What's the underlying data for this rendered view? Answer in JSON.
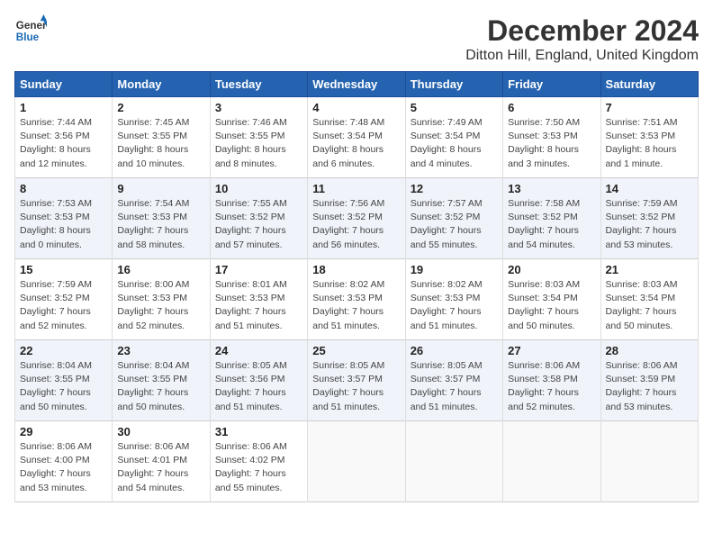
{
  "header": {
    "logo_line1": "General",
    "logo_line2": "Blue",
    "month": "December 2024",
    "location": "Ditton Hill, England, United Kingdom"
  },
  "days_of_week": [
    "Sunday",
    "Monday",
    "Tuesday",
    "Wednesday",
    "Thursday",
    "Friday",
    "Saturday"
  ],
  "weeks": [
    [
      {
        "day": 1,
        "sunrise": "7:44 AM",
        "sunset": "3:56 PM",
        "daylight": "8 hours and 12 minutes"
      },
      {
        "day": 2,
        "sunrise": "7:45 AM",
        "sunset": "3:55 PM",
        "daylight": "8 hours and 10 minutes"
      },
      {
        "day": 3,
        "sunrise": "7:46 AM",
        "sunset": "3:55 PM",
        "daylight": "8 hours and 8 minutes"
      },
      {
        "day": 4,
        "sunrise": "7:48 AM",
        "sunset": "3:54 PM",
        "daylight": "8 hours and 6 minutes"
      },
      {
        "day": 5,
        "sunrise": "7:49 AM",
        "sunset": "3:54 PM",
        "daylight": "8 hours and 4 minutes"
      },
      {
        "day": 6,
        "sunrise": "7:50 AM",
        "sunset": "3:53 PM",
        "daylight": "8 hours and 3 minutes"
      },
      {
        "day": 7,
        "sunrise": "7:51 AM",
        "sunset": "3:53 PM",
        "daylight": "8 hours and 1 minute"
      }
    ],
    [
      {
        "day": 8,
        "sunrise": "7:53 AM",
        "sunset": "3:53 PM",
        "daylight": "8 hours and 0 minutes"
      },
      {
        "day": 9,
        "sunrise": "7:54 AM",
        "sunset": "3:53 PM",
        "daylight": "7 hours and 58 minutes"
      },
      {
        "day": 10,
        "sunrise": "7:55 AM",
        "sunset": "3:52 PM",
        "daylight": "7 hours and 57 minutes"
      },
      {
        "day": 11,
        "sunrise": "7:56 AM",
        "sunset": "3:52 PM",
        "daylight": "7 hours and 56 minutes"
      },
      {
        "day": 12,
        "sunrise": "7:57 AM",
        "sunset": "3:52 PM",
        "daylight": "7 hours and 55 minutes"
      },
      {
        "day": 13,
        "sunrise": "7:58 AM",
        "sunset": "3:52 PM",
        "daylight": "7 hours and 54 minutes"
      },
      {
        "day": 14,
        "sunrise": "7:59 AM",
        "sunset": "3:52 PM",
        "daylight": "7 hours and 53 minutes"
      }
    ],
    [
      {
        "day": 15,
        "sunrise": "7:59 AM",
        "sunset": "3:52 PM",
        "daylight": "7 hours and 52 minutes"
      },
      {
        "day": 16,
        "sunrise": "8:00 AM",
        "sunset": "3:53 PM",
        "daylight": "7 hours and 52 minutes"
      },
      {
        "day": 17,
        "sunrise": "8:01 AM",
        "sunset": "3:53 PM",
        "daylight": "7 hours and 51 minutes"
      },
      {
        "day": 18,
        "sunrise": "8:02 AM",
        "sunset": "3:53 PM",
        "daylight": "7 hours and 51 minutes"
      },
      {
        "day": 19,
        "sunrise": "8:02 AM",
        "sunset": "3:53 PM",
        "daylight": "7 hours and 51 minutes"
      },
      {
        "day": 20,
        "sunrise": "8:03 AM",
        "sunset": "3:54 PM",
        "daylight": "7 hours and 50 minutes"
      },
      {
        "day": 21,
        "sunrise": "8:03 AM",
        "sunset": "3:54 PM",
        "daylight": "7 hours and 50 minutes"
      }
    ],
    [
      {
        "day": 22,
        "sunrise": "8:04 AM",
        "sunset": "3:55 PM",
        "daylight": "7 hours and 50 minutes"
      },
      {
        "day": 23,
        "sunrise": "8:04 AM",
        "sunset": "3:55 PM",
        "daylight": "7 hours and 50 minutes"
      },
      {
        "day": 24,
        "sunrise": "8:05 AM",
        "sunset": "3:56 PM",
        "daylight": "7 hours and 51 minutes"
      },
      {
        "day": 25,
        "sunrise": "8:05 AM",
        "sunset": "3:57 PM",
        "daylight": "7 hours and 51 minutes"
      },
      {
        "day": 26,
        "sunrise": "8:05 AM",
        "sunset": "3:57 PM",
        "daylight": "7 hours and 51 minutes"
      },
      {
        "day": 27,
        "sunrise": "8:06 AM",
        "sunset": "3:58 PM",
        "daylight": "7 hours and 52 minutes"
      },
      {
        "day": 28,
        "sunrise": "8:06 AM",
        "sunset": "3:59 PM",
        "daylight": "7 hours and 53 minutes"
      }
    ],
    [
      {
        "day": 29,
        "sunrise": "8:06 AM",
        "sunset": "4:00 PM",
        "daylight": "7 hours and 53 minutes"
      },
      {
        "day": 30,
        "sunrise": "8:06 AM",
        "sunset": "4:01 PM",
        "daylight": "7 hours and 54 minutes"
      },
      {
        "day": 31,
        "sunrise": "8:06 AM",
        "sunset": "4:02 PM",
        "daylight": "7 hours and 55 minutes"
      },
      null,
      null,
      null,
      null
    ]
  ]
}
